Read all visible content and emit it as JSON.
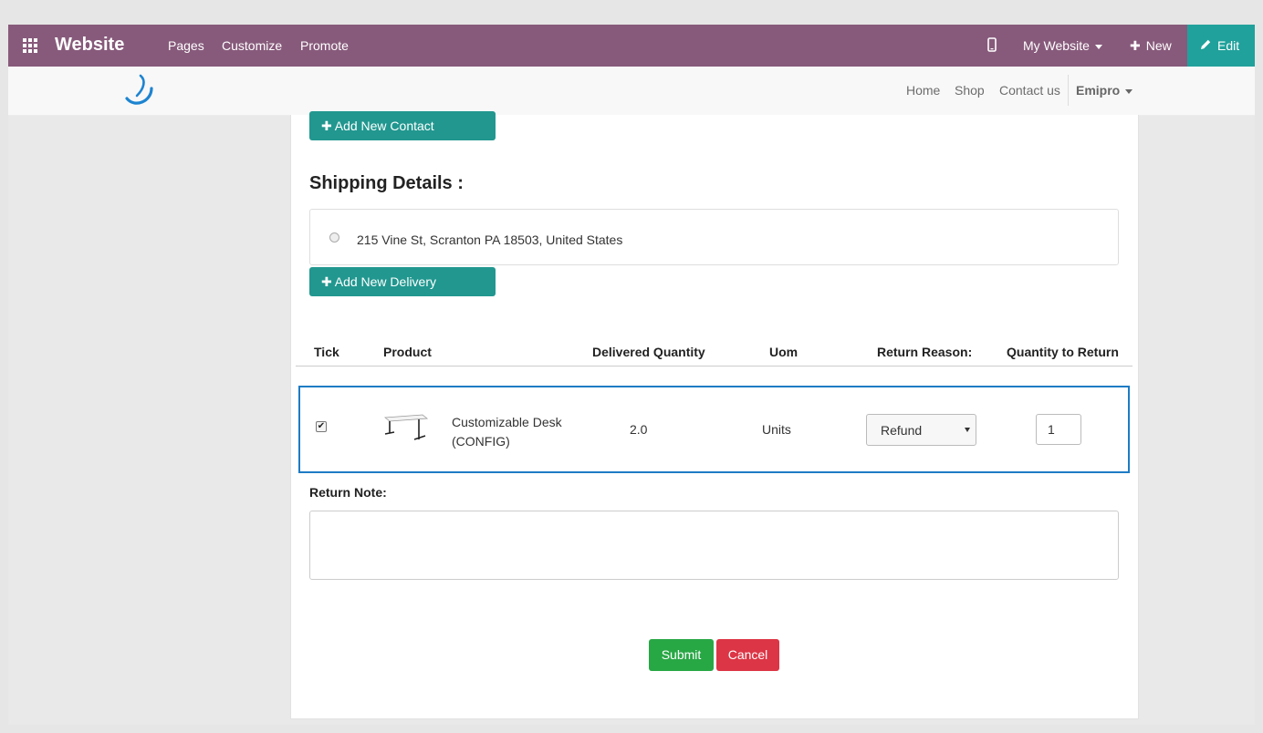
{
  "topbar": {
    "app_title": "Website",
    "menu": [
      "Pages",
      "Customize",
      "Promote"
    ],
    "website_selector": "My Website",
    "new_label": "New",
    "edit_label": "Edit",
    "color": "#875a7b",
    "edit_color": "#21a19b"
  },
  "navbar": {
    "links": [
      "Home",
      "Shop",
      "Contact us"
    ],
    "user": "Emipro"
  },
  "contact": {
    "add_contact_label": "Add New Contact Address"
  },
  "shipping": {
    "title": "Shipping Details :",
    "address": "215 Vine St, Scranton PA 18503, United States",
    "add_delivery_label": "Add New Delivery Address"
  },
  "table": {
    "headers": {
      "tick": "Tick",
      "product": "Product",
      "delivered": "Delivered Quantity",
      "uom": "Uom",
      "reason": "Return Reason:",
      "qty": "Quantity to Return"
    },
    "rows": [
      {
        "checked": true,
        "product_name": "Customizable Desk (CONFIG)",
        "delivered_qty": "2.0",
        "uom": "Units",
        "return_reason": "Refund",
        "qty_to_return": "1"
      }
    ]
  },
  "note": {
    "label": "Return Note:",
    "value": ""
  },
  "actions": {
    "submit": "Submit",
    "cancel": "Cancel"
  }
}
